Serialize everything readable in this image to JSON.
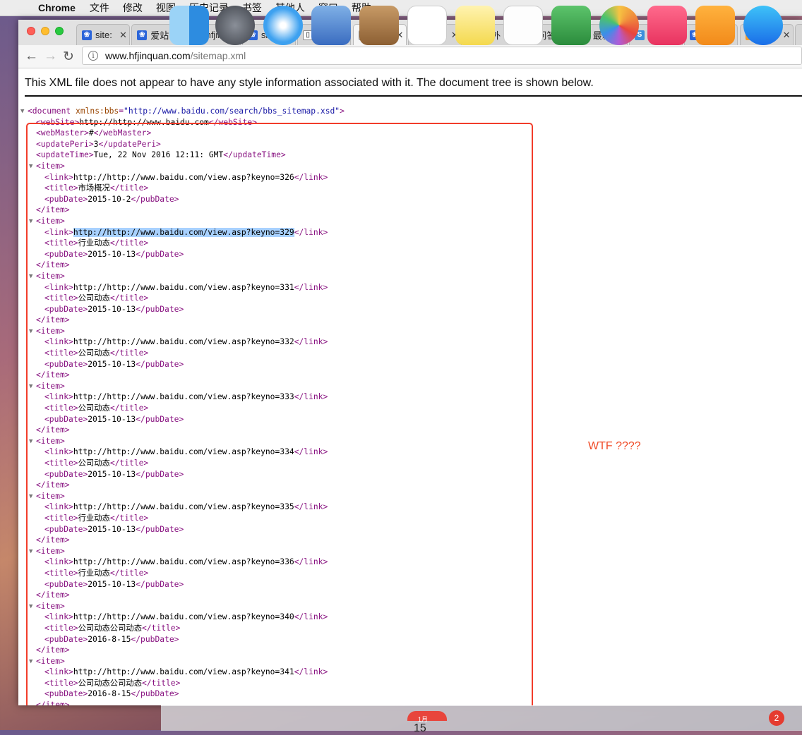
{
  "menubar": {
    "app": "Chrome",
    "items": [
      "文件",
      "修改",
      "视图",
      "历史记录",
      "书签",
      "其他人",
      "窗口",
      "帮助"
    ]
  },
  "tabs": [
    {
      "label": "site:",
      "icon": "baidu-paw-icon",
      "active": false
    },
    {
      "label": "爱站",
      "icon": "baidu-paw-icon",
      "active": false
    },
    {
      "label": "hfjin",
      "icon": "site-icon",
      "active": false
    },
    {
      "label": "site:",
      "icon": "baidu-paw-icon",
      "active": false
    },
    {
      "label": "合肥",
      "icon": "page-icon",
      "active": false
    },
    {
      "label": "www",
      "icon": "page-icon",
      "active": true
    },
    {
      "label": "个人",
      "icon": "s-icon",
      "active": false
    },
    {
      "label": "搜外",
      "icon": "s-icon",
      "active": false
    },
    {
      "label": "问答",
      "icon": "s-icon",
      "active": false
    },
    {
      "label": "最新",
      "icon": "s-icon",
      "active": false
    },
    {
      "label": "网站",
      "icon": "s-icon",
      "active": false
    },
    {
      "label": "site:",
      "icon": "baidu-paw-icon",
      "active": false
    },
    {
      "label": "邦诚",
      "icon": "bangcheng-icon",
      "active": false
    }
  ],
  "address": {
    "host": "www.hfjinquan.com",
    "path": "/sitemap.xml"
  },
  "banner": "This XML file does not appear to have any style information associated with it. The document tree is shown below.",
  "xml": {
    "root_tag": "document",
    "root_attr_name": "xmlns:bbs",
    "root_attr_value": "\"http://www.baidu.com/search/bbs_sitemap.xsd\"",
    "webSite": "http://http://www.baidu.com",
    "webMaster": "#",
    "updatePeri": "3",
    "updateTime": "Tue, 22 Nov 2016 12:11: GMT",
    "items": [
      {
        "link": "http://http://www.baidu.com/view.asp?keyno=326",
        "title": "市场概况",
        "pubDate": "2015-10-2"
      },
      {
        "link": "http://http://www.baidu.com/view.asp?keyno=329",
        "title": "行业动态",
        "pubDate": "2015-10-13"
      },
      {
        "link": "http://http://www.baidu.com/view.asp?keyno=331",
        "title": "公司动态",
        "pubDate": "2015-10-13"
      },
      {
        "link": "http://http://www.baidu.com/view.asp?keyno=332",
        "title": "公司动态",
        "pubDate": "2015-10-13"
      },
      {
        "link": "http://http://www.baidu.com/view.asp?keyno=333",
        "title": "公司动态",
        "pubDate": "2015-10-13"
      },
      {
        "link": "http://http://www.baidu.com/view.asp?keyno=334",
        "title": "公司动态",
        "pubDate": "2015-10-13"
      },
      {
        "link": "http://http://www.baidu.com/view.asp?keyno=335",
        "title": "行业动态",
        "pubDate": "2015-10-13"
      },
      {
        "link": "http://http://www.baidu.com/view.asp?keyno=336",
        "title": "行业动态",
        "pubDate": "2015-10-13"
      },
      {
        "link": "http://http://www.baidu.com/view.asp?keyno=340",
        "title": "公司动态公司动态",
        "pubDate": "2016-8-15"
      },
      {
        "link": "http://http://www.baidu.com/view.asp?keyno=341",
        "title": "公司动态公司动态",
        "pubDate": "2016-8-15"
      }
    ],
    "highlighted_item": 1
  },
  "annotation": "WTF ????",
  "dock": {
    "calendar_month": "1月",
    "calendar_day": "15",
    "badge": "2"
  },
  "colors": {
    "annotation": "#f04a26",
    "box": "#f23c2a",
    "tag": "#881280",
    "attr": "#994500",
    "highlight": "#a8d1ff"
  }
}
